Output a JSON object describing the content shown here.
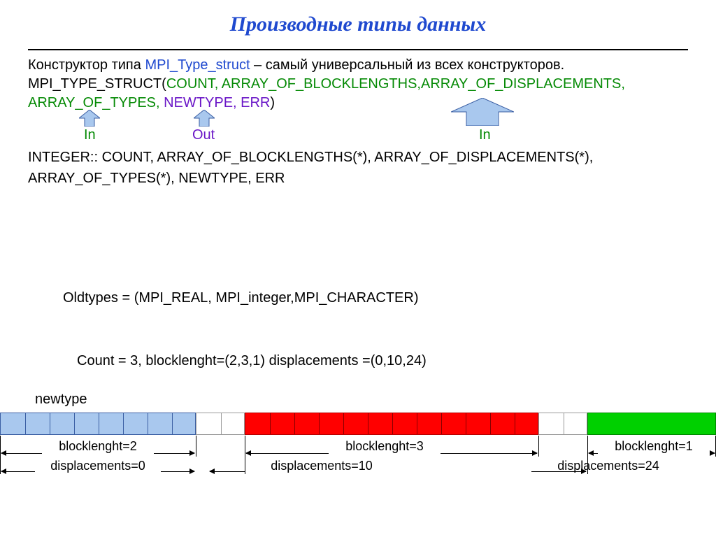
{
  "title": "Производные типы данных",
  "intro": {
    "prefix": "Конструктор типа ",
    "fname": "MPI_Type_struct",
    "suffix": " – самый универсальный из всех конструкторов."
  },
  "sig": {
    "head": "MPI_TYPE_STRUCT(",
    "args_green": "COUNT,  ARRAY_OF_BLOCKLENGTHS,ARRAY_OF_DISPLACEMENTS, ARRAY_OF_TYPES,",
    "args_purple": "  NEWTYPE, ERR",
    "close": ")"
  },
  "io": {
    "in": "In",
    "out": "Out"
  },
  "decl1": "INTEGER:: COUNT, ARRAY_OF_BLOCKLENGTHS(*),  ARRAY_OF_DISPLACEMENTS(*),",
  "decl2": "ARRAY_OF_TYPES(*),  NEWTYPE, ERR",
  "oldtypes": "Oldtypes  = (MPI_REAL, MPI_integer,MPI_CHARACTER)",
  "count_line": "Count = 3, blocklenght=(2,3,1)  displacements  =(0,10,24)",
  "newtype": "newtype",
  "diagram": {
    "bl1": "blocklenght=2",
    "bl2": "blocklenght=3",
    "bl3": "blocklenght=1",
    "d1": "displacements=0",
    "d2": "displacements=10",
    "d3": "displacements=24"
  }
}
